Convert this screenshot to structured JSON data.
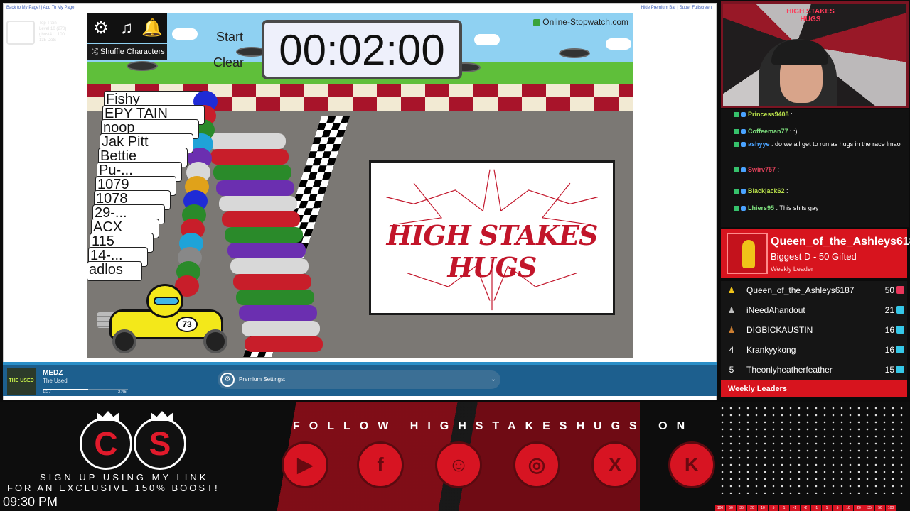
{
  "browser": {
    "top_links_left": "Back to My Page! | Add To My Page!",
    "top_links_right": "Hide Premium Bar | Super Fullscreen",
    "ghost_info": [
      "Top Train",
      "Level 10 (270)",
      "ghost411 100",
      "135 Dots"
    ]
  },
  "game": {
    "controls": {
      "shuffle_label": "Shuffle Characters",
      "start_label": "Start",
      "clear_label": "Clear"
    },
    "timer": "00:02:00",
    "brand": "Online-Stopwatch.com",
    "name_cards": [
      "Fishy",
      "EPY TAIN",
      "noop",
      "Jak Pitt",
      "Bettie",
      "Pu-...",
      "1079",
      "1078",
      "29-...",
      "ACX",
      "115",
      "14-...",
      "adlos"
    ],
    "kart_number": "73",
    "logo_text": "HIGH STAKES HUGS"
  },
  "player": {
    "song": "MEDZ",
    "artist": "The Used",
    "album_art_text": "THE USED",
    "time_elapsed": "1:27",
    "time_total": "2:46",
    "progress": 0.53,
    "premium_label": "Premium Settings:"
  },
  "webcam": {
    "sign_text": "HIGH STAKES HUGS"
  },
  "chat": {
    "messages": [
      {
        "user": "Princess9408",
        "text": "",
        "color": "#b8e04a"
      },
      {
        "user": "Coffeeman77",
        "text": ":)",
        "color": "#7ee07e"
      },
      {
        "user": "ashyye",
        "text": "do we all get to run as hugs in the race lmao",
        "color": "#4aa3ff"
      },
      {
        "user": "Swirv757",
        "text": "",
        "color": "#e0415a"
      },
      {
        "user": "Blackjack62",
        "text": "",
        "color": "#b8e04a"
      },
      {
        "user": "Lhiers95",
        "text": "This shits gay",
        "color": "#7ee07e"
      }
    ]
  },
  "leader": {
    "name": "Queen_of_the_Ashleys6187",
    "subtitle": "Biggest D - 50 Gifted",
    "tag": "Weekly Leader"
  },
  "board": {
    "rows": [
      {
        "rank": "",
        "name": "Queen_of_the_Ashleys6187",
        "score": "50",
        "gift_color": "#e8365a",
        "rank_color": "#f0c419"
      },
      {
        "rank": "",
        "name": "iNeedAhandout",
        "score": "21",
        "gift_color": "#36c8e8",
        "rank_color": "#c0c0c0"
      },
      {
        "rank": "",
        "name": "DIGBICKAUSTIN",
        "score": "16",
        "gift_color": "#36c8e8",
        "rank_color": "#cd7f32"
      },
      {
        "rank": "4",
        "name": "Krankyykong",
        "score": "16",
        "gift_color": "#36c8e8",
        "rank_color": "#ffffff"
      },
      {
        "rank": "5",
        "name": "Theonlyheatherfeather",
        "score": "15",
        "gift_color": "#36c8e8",
        "rank_color": "#ffffff"
      }
    ],
    "footer": "Weekly Leaders"
  },
  "banner": {
    "cs_letters": [
      "C",
      "S"
    ],
    "signup_line1": "SIGN UP USING MY LINK",
    "signup_line2": "FOR AN EXCLUSIVE 150% BOOST!",
    "clock": "09:30 PM",
    "follow_text": "FOLLOW HIGHSTAKESHUGS ON",
    "socials": [
      "youtube-icon",
      "facebook-icon",
      "guilded-icon",
      "instagram-icon",
      "x-icon",
      "kick-icon"
    ],
    "social_glyphs": [
      "▶",
      "f",
      "☺",
      "◎",
      "X",
      "K"
    ],
    "meter": [
      "100",
      "50",
      "35",
      "20",
      "10",
      "5",
      "1",
      "-1",
      "-2",
      "-1",
      "1",
      "5",
      "10",
      "20",
      "35",
      "50",
      "100"
    ]
  },
  "colors": {
    "accent": "#d7141e",
    "player_bar": "#1d5f8e",
    "timer_bg": "#eef0fb"
  }
}
